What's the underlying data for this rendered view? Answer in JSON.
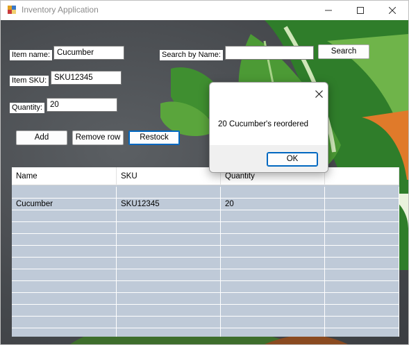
{
  "window": {
    "title": "Inventory Application",
    "icons": {
      "app": "app-icon",
      "minimize": "minimize-icon",
      "maximize": "maximize-icon",
      "close": "close-icon"
    }
  },
  "form": {
    "item_name_label": "Item name:",
    "item_name_value": "Cucumber",
    "item_sku_label": "Item SKU:",
    "item_sku_value": "SKU12345",
    "quantity_label": "Quantity:",
    "quantity_value": "20",
    "search_label": "Search by Name:",
    "search_value": "",
    "search_button": "Search"
  },
  "actions": {
    "add": "Add",
    "remove_row": "Remove row",
    "restock": "Restock"
  },
  "grid": {
    "columns": [
      "Name",
      "SKU",
      "Quantity",
      ""
    ],
    "rows": [
      [
        "",
        "",
        "",
        ""
      ],
      [
        "Cucumber",
        "SKU12345",
        "20",
        ""
      ],
      [
        "",
        "",
        "",
        ""
      ],
      [
        "",
        "",
        "",
        ""
      ],
      [
        "",
        "",
        "",
        ""
      ],
      [
        "",
        "",
        "",
        ""
      ],
      [
        "",
        "",
        "",
        ""
      ],
      [
        "",
        "",
        "",
        ""
      ],
      [
        "",
        "",
        "",
        ""
      ],
      [
        "",
        "",
        "",
        ""
      ],
      [
        "",
        "",
        "",
        ""
      ],
      [
        "",
        "",
        "",
        ""
      ],
      [
        "",
        "",
        "",
        ""
      ]
    ]
  },
  "dialog": {
    "message": "20 Cucumber's reordered",
    "ok_label": "OK",
    "close_icon": "close-icon"
  }
}
